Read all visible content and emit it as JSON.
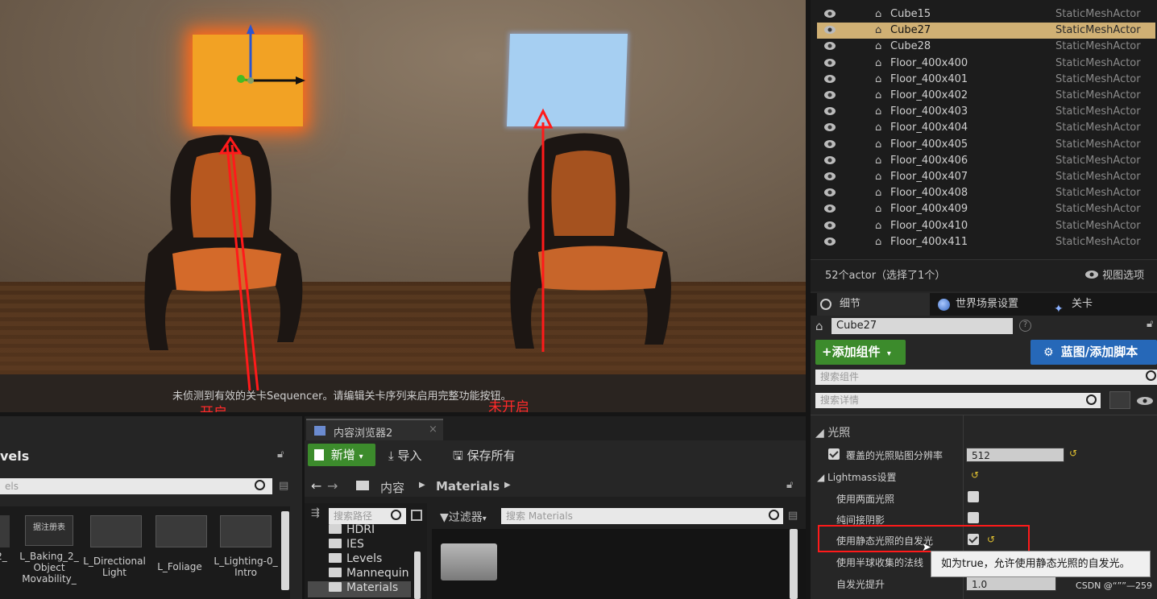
{
  "viewport": {
    "message": "未侦测到有效的关卡Sequencer。请编辑关卡序列来启用完整功能按钮。",
    "annotation_on": "开启",
    "annotation_off": "未开启"
  },
  "outliner": {
    "rows": [
      {
        "name": "Cube15",
        "type": "StaticMeshActor",
        "selected": false
      },
      {
        "name": "Cube27",
        "type": "StaticMeshActor",
        "selected": true
      },
      {
        "name": "Cube28",
        "type": "StaticMeshActor",
        "selected": false
      },
      {
        "name": "Floor_400x400",
        "type": "StaticMeshActor",
        "selected": false
      },
      {
        "name": "Floor_400x401",
        "type": "StaticMeshActor",
        "selected": false
      },
      {
        "name": "Floor_400x402",
        "type": "StaticMeshActor",
        "selected": false
      },
      {
        "name": "Floor_400x403",
        "type": "StaticMeshActor",
        "selected": false
      },
      {
        "name": "Floor_400x404",
        "type": "StaticMeshActor",
        "selected": false
      },
      {
        "name": "Floor_400x405",
        "type": "StaticMeshActor",
        "selected": false
      },
      {
        "name": "Floor_400x406",
        "type": "StaticMeshActor",
        "selected": false
      },
      {
        "name": "Floor_400x407",
        "type": "StaticMeshActor",
        "selected": false
      },
      {
        "name": "Floor_400x408",
        "type": "StaticMeshActor",
        "selected": false
      },
      {
        "name": "Floor_400x409",
        "type": "StaticMeshActor",
        "selected": false
      },
      {
        "name": "Floor_400x410",
        "type": "StaticMeshActor",
        "selected": false
      },
      {
        "name": "Floor_400x411",
        "type": "StaticMeshActor",
        "selected": false
      }
    ],
    "footer_count": "52个actor（选择了1个）",
    "view_options": "视图选项"
  },
  "details": {
    "tabs": [
      "细节",
      "世界场景设置",
      "关卡"
    ],
    "actor_name": "Cube27",
    "add_component": "+添加组件",
    "blueprint": "蓝图/添加脚本",
    "search_components": "搜索组件",
    "search_details": "搜索详情",
    "section": "光照",
    "props": {
      "override_lightmap_res": "覆盖的光照贴图分辨率",
      "override_lightmap_res_value": "512",
      "lightmass_settings": "Lightmass设置",
      "two_sided": "使用两面光照",
      "shadow_indirect": "纯间接阴影",
      "emissive_static": "使用静态光照的自发光",
      "hemisphere_normals": "使用半球收集的法线",
      "emissive_boost": "自发光提升",
      "emissive_boost_value": "1.0"
    },
    "tooltip": "如为true，允许使用静态光照的自发光。"
  },
  "levels": {
    "title": "vels",
    "search_placeholder": "els",
    "thumbnails": [
      {
        "label": "2_"
      },
      {
        "label": "L_Baking_2_ Object Movability_"
      },
      {
        "label": "L_Directional Light"
      },
      {
        "label": "L_Foliage"
      },
      {
        "label": "L_Lighting-0_ Intro"
      }
    ],
    "stamp": "据注册表"
  },
  "content_browser": {
    "tab": "内容浏览器2",
    "new": "新增",
    "import": "导入",
    "save_all": "保存所有",
    "path_root": "内容",
    "path_current": "Materials",
    "search_paths": "搜索路径",
    "filters": "过滤器",
    "search_materials": "搜索 Materials",
    "tree": [
      "HDRI",
      "IES",
      "Levels",
      "Mannequin",
      "Materials"
    ]
  },
  "watermark": "CSDN @“””—259"
}
